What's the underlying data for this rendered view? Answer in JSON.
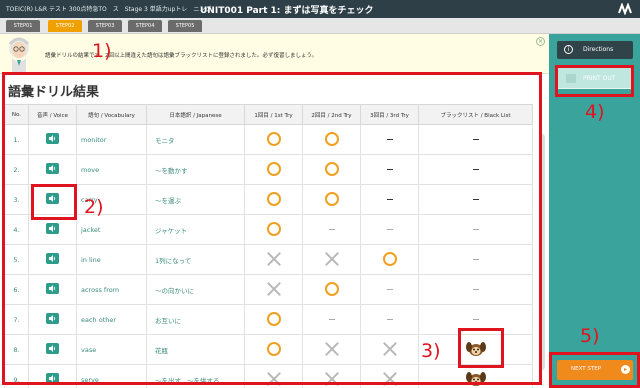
{
  "header": {
    "crumb": "TOEIC(R) L&R テスト 300点特急TO　ス　Stage 3 単語力upトレ　ニング",
    "title": "UNIT001 Part 1: まずは写真をチェック"
  },
  "steps": [
    "STEP01",
    "STEP02",
    "STEP03",
    "STEP04",
    "STEP05"
  ],
  "banner": {
    "message": "語彙ドリルの結果です。2回以上間違えた語句は語彙ブラックリストに登録されました。必ず復習しましょう。"
  },
  "drill": {
    "title": "語彙ドリル結果",
    "columns": [
      "No.",
      "音声 / Voice",
      "語句 / Vocabulary",
      "日本語訳 / Japanese",
      "1回目 / 1st Try",
      "2回目 / 2nd Try",
      "3回目 / 3rd Try",
      "ブラックリスト / Black List"
    ],
    "rows": [
      {
        "no": "1.",
        "vocab": "monitor",
        "ja": "モニタ",
        "t1": "o",
        "t2": "o",
        "t3": "-",
        "bl": "-"
      },
      {
        "no": "2.",
        "vocab": "move",
        "ja": "～を動かす",
        "t1": "o",
        "t2": "o",
        "t3": "-",
        "bl": "-"
      },
      {
        "no": "3.",
        "vocab": "carry",
        "ja": "～を運ぶ",
        "t1": "o",
        "t2": "o",
        "t3": "-",
        "bl": "-"
      },
      {
        "no": "4.",
        "vocab": "jacket",
        "ja": "ジャケット",
        "t1": "o",
        "t2": "-",
        "t3": "-",
        "bl": "-"
      },
      {
        "no": "5.",
        "vocab": "in line",
        "ja": "1列になって",
        "t1": "x",
        "t2": "x",
        "t3": "o",
        "bl": "-"
      },
      {
        "no": "6.",
        "vocab": "across from",
        "ja": "～の向かいに",
        "t1": "x",
        "t2": "o",
        "t3": "-",
        "bl": "-"
      },
      {
        "no": "7.",
        "vocab": "each other",
        "ja": "お互いに",
        "t1": "o",
        "t2": "-",
        "t3": "-",
        "bl": "-"
      },
      {
        "no": "8.",
        "vocab": "vase",
        "ja": "花瓶",
        "t1": "o",
        "t2": "x",
        "t3": "x",
        "bl": "dog"
      },
      {
        "no": "9.",
        "vocab": "serve",
        "ja": "～を出す、～を供する",
        "t1": "x",
        "t2": "x",
        "t3": "x",
        "bl": "dog"
      }
    ]
  },
  "sidebar": {
    "directions_label": "Directions",
    "print_label": "PRINT OUT",
    "next_label": "NEXT STEP"
  },
  "annotations": [
    "1)",
    "2)",
    "3)",
    "4)",
    "5)"
  ],
  "colors": {
    "accent_orange": "#f0a020",
    "teal": "#3aa39b",
    "annotation_red": "#e0141e"
  }
}
